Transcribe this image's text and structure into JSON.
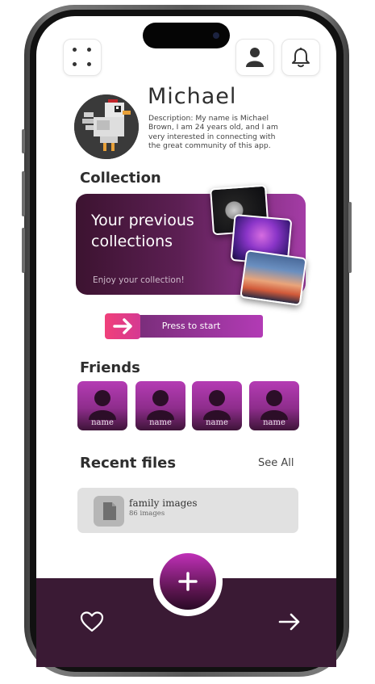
{
  "profile": {
    "name": "Michael",
    "description": "Description: My name is Michael Brown, I am 24 years old, and I am very interested in connecting with the great community of this app."
  },
  "collection": {
    "section_title": "Collection",
    "card_title": "Your previous collections",
    "card_subtitle": "Enjoy your collection!",
    "start_button": "Press to start"
  },
  "friends": {
    "section_title": "Friends",
    "items": [
      {
        "label": "name"
      },
      {
        "label": "name"
      },
      {
        "label": "name"
      },
      {
        "label": "name"
      }
    ]
  },
  "recent_files": {
    "section_title": "Recent files",
    "see_all": "See All",
    "items": [
      {
        "name": "family images",
        "count": "86 images"
      }
    ]
  },
  "icons": {
    "top_left": "grid-dots-icon",
    "top_right_1": "user-icon",
    "top_right_2": "bell-icon",
    "bottom_left": "heart-icon",
    "bottom_center": "plus-icon",
    "bottom_right": "arrow-right-icon",
    "file": "file-icon"
  },
  "colors": {
    "accent": "#b23bb5",
    "dark_bar": "#3a1a34",
    "start_arrow": "#f0407a"
  }
}
